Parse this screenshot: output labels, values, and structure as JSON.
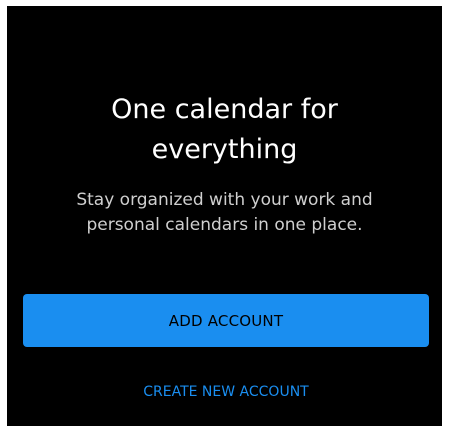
{
  "onboarding": {
    "title_line1": "One calendar for",
    "title_line2": "everything",
    "subtitle_line1": "Stay organized with your work and",
    "subtitle_line2": "personal calendars in one place."
  },
  "actions": {
    "add_account_label": "ADD ACCOUNT",
    "create_account_label": "CREATE NEW ACCOUNT"
  },
  "colors": {
    "background": "#000000",
    "accent": "#1a8ef0",
    "title_text": "#ffffff",
    "subtitle_text": "#cfcfcf"
  }
}
